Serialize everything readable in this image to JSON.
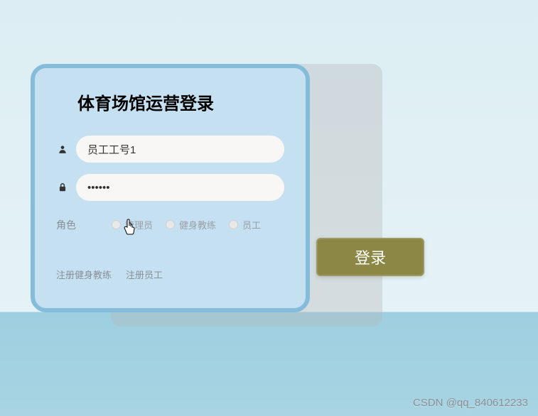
{
  "title": "体育场馆运营登录",
  "fields": {
    "username": {
      "value": "员工工号1"
    },
    "password": {
      "value": "••••••"
    }
  },
  "role": {
    "label": "角色",
    "options": [
      "管理员",
      "健身教练",
      "员工"
    ]
  },
  "links": {
    "registerCoach": "注册健身教练",
    "registerStaff": "注册员工"
  },
  "loginButton": "登录",
  "watermark": "CSDN @qq_840612233"
}
